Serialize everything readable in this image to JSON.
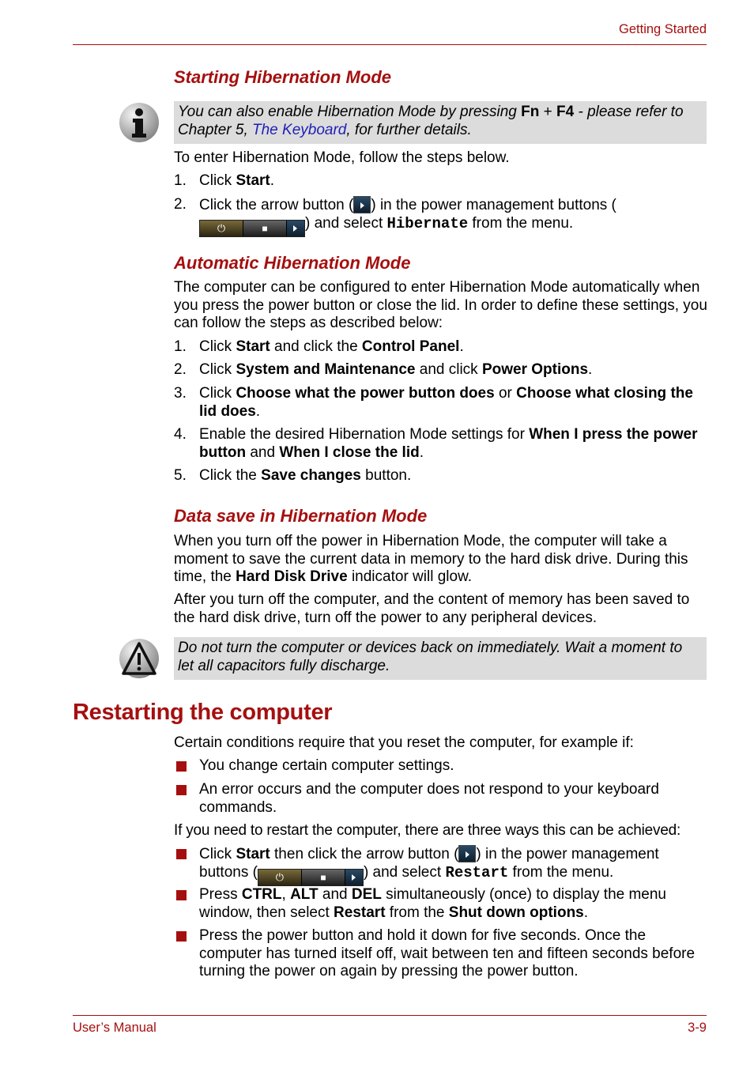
{
  "header": {
    "section_title": "Getting Started"
  },
  "sections": {
    "starting": {
      "title": "Starting Hibernation Mode",
      "note": {
        "pre": "You can also enable Hibernation Mode by pressing ",
        "key1": "Fn",
        "plus": " + ",
        "key2": "F4",
        "mid": " - please refer to Chapter 5, ",
        "link": "The Keyboard",
        "post": ", for further details."
      },
      "intro": "To enter Hibernation Mode, follow the steps below.",
      "steps": [
        {
          "num": "1.",
          "pre": "Click ",
          "bold": "Start",
          "post": "."
        },
        {
          "num": "2.",
          "pre": "Click the arrow button (",
          "mid": ") in the power management buttons (",
          "mid2": ") and select ",
          "code": "Hibernate",
          "post": " from the menu."
        }
      ]
    },
    "automatic": {
      "title": "Automatic Hibernation Mode",
      "intro": "The computer can be configured to enter Hibernation Mode automatically when you press the power button or close the lid. In order to define these settings, you can follow the steps as described below:",
      "steps": [
        {
          "num": "1.",
          "a": "Click ",
          "b": "Start",
          "c": " and click the ",
          "d": "Control Panel",
          "e": "."
        },
        {
          "num": "2.",
          "a": "Click ",
          "b": "System and Maintenance",
          "c": " and click ",
          "d": "Power Options",
          "e": "."
        },
        {
          "num": "3.",
          "a": "Click ",
          "b": "Choose what the power button does",
          "c": " or ",
          "d": "Choose what closing the lid does",
          "e": "."
        },
        {
          "num": "4.",
          "a": "Enable the desired Hibernation Mode settings for ",
          "b": "When I press the power button",
          "c": " and ",
          "d": "When I close the lid",
          "e": "."
        },
        {
          "num": "5.",
          "a": "Click the ",
          "b": "Save changes",
          "c": " button.",
          "d": "",
          "e": ""
        }
      ]
    },
    "datasave": {
      "title": "Data save in Hibernation Mode",
      "p1_pre": "When you turn off the power in Hibernation Mode, the computer will take a moment to save the current data in memory to the hard disk drive. During this time, the ",
      "p1_bold": "Hard Disk Drive",
      "p1_post": " indicator will glow.",
      "p2": "After you turn off the computer, and the content of memory has been saved to the hard disk drive, turn off the power to any peripheral devices.",
      "caution": "Do not turn the computer or devices back on immediately. Wait a moment to let all capacitors fully discharge."
    },
    "restarting": {
      "title": "Restarting the computer",
      "intro": "Certain conditions require that you reset the computer, for example if:",
      "conditions": [
        "You change certain computer settings.",
        "An error occurs and the computer does not respond to your keyboard commands."
      ],
      "ways_intro": "If you need to restart the computer, there are three ways this can be achieved:",
      "way1": {
        "a": "Click ",
        "b": "Start",
        "c": " then click the arrow button (",
        "d": ") in the power management buttons (",
        "e": ") and select ",
        "code": "Restart",
        "f": " from the menu."
      },
      "way2": {
        "a": "Press ",
        "b": "CTRL",
        "c": ", ",
        "d": "ALT",
        "e": " and ",
        "f": "DEL",
        "g": " simultaneously (once) to display the menu window, then select ",
        "h": "Restart",
        "i": " from the ",
        "j": "Shut down options",
        "k": "."
      },
      "way3": "Press the power button and hold it down for five seconds. Once the computer has turned itself off, wait between ten and fifteen seconds before turning the power on again by pressing the power button."
    }
  },
  "icons": {
    "info": "info-icon",
    "caution": "caution-icon",
    "power": "⏻",
    "lock": "🔒"
  },
  "footer": {
    "left": "User’s Manual",
    "right": "3-9"
  },
  "colors": {
    "accent": "#a50f0f",
    "note_bg": "#dcdcdc",
    "link": "#1f1fb8"
  }
}
